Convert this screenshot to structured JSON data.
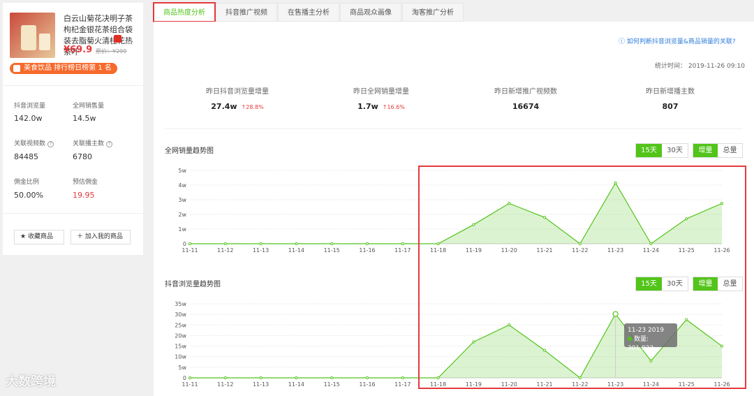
{
  "product": {
    "title": "白云山菊花决明子茶枸杞金银花茶组合袋装去脂菊火清桂花热茶叶",
    "price": "¥69.9",
    "orig_price": "原价：¥299",
    "rank_badge": "美食饮品 排行榜日榜第 1 名"
  },
  "stats": [
    {
      "label": "抖音浏览量",
      "value": "142.0w"
    },
    {
      "label": "全网销售量",
      "value": "14.5w"
    },
    {
      "label": "关联视频数",
      "value": "84485"
    },
    {
      "label": "关联播主数",
      "value": "6780"
    },
    {
      "label": "佣金比例",
      "value": "50.00%"
    },
    {
      "label": "预估佣金",
      "value": "19.95"
    }
  ],
  "buttons": {
    "collect": "收藏商品",
    "add": "加入我的商品"
  },
  "tabs": [
    "商品热度分析",
    "抖音推广视频",
    "在售播主分析",
    "商品观众画像",
    "淘客推广分析"
  ],
  "help_link": "如何判断抖音浏览量&商品销量的关联?",
  "stat_time": "统计时间： 2019-11-26 09:10",
  "summary": [
    {
      "label": "昨日抖音浏览量增量",
      "value": "27.4w",
      "change": "↑28.8%"
    },
    {
      "label": "昨日全网销量增量",
      "value": "1.7w",
      "change": "↑16.6%"
    },
    {
      "label": "昨日新增推广视频数",
      "value": "16674",
      "change": ""
    },
    {
      "label": "昨日新增播主数",
      "value": "807",
      "change": ""
    }
  ],
  "controls": {
    "d15": "15天",
    "d30": "30天",
    "inc": "增量",
    "total": "总量"
  },
  "tooltip": {
    "title": "11-23 2019",
    "text": "数量: 301,923"
  },
  "watermark": "大数跨境",
  "colors": {
    "accent": "#52c41a",
    "red": "#e4393c"
  },
  "chart_data": [
    {
      "type": "area",
      "title": "全网销量趋势图",
      "categories": [
        "11-11",
        "11-12",
        "11-13",
        "11-14",
        "11-15",
        "11-16",
        "11-17",
        "11-18",
        "11-19",
        "11-20",
        "11-21",
        "11-22",
        "11-23",
        "11-24",
        "11-25",
        "11-26"
      ],
      "values": [
        0,
        0,
        0,
        0,
        0,
        0,
        0,
        0,
        13000,
        27500,
        18000,
        0,
        41500,
        0,
        17000,
        27500
      ],
      "ylim": [
        0,
        50000
      ],
      "yticks": [
        "0",
        "1w",
        "2w",
        "3w",
        "4w",
        "5w"
      ],
      "grid": true
    },
    {
      "type": "area",
      "title": "抖音浏览量趋势图",
      "categories": [
        "11-11",
        "11-12",
        "11-13",
        "11-14",
        "11-15",
        "11-16",
        "11-17",
        "11-18",
        "11-19",
        "11-20",
        "11-21",
        "11-22",
        "11-23",
        "11-24",
        "11-25",
        "11-26"
      ],
      "values": [
        0,
        0,
        0,
        0,
        0,
        0,
        0,
        0,
        170000,
        250000,
        130000,
        0,
        301923,
        80000,
        275000,
        150000
      ],
      "ylim": [
        0,
        350000
      ],
      "yticks": [
        "0",
        "5w",
        "10w",
        "15w",
        "20w",
        "25w",
        "30w",
        "35w"
      ],
      "grid": true
    }
  ]
}
